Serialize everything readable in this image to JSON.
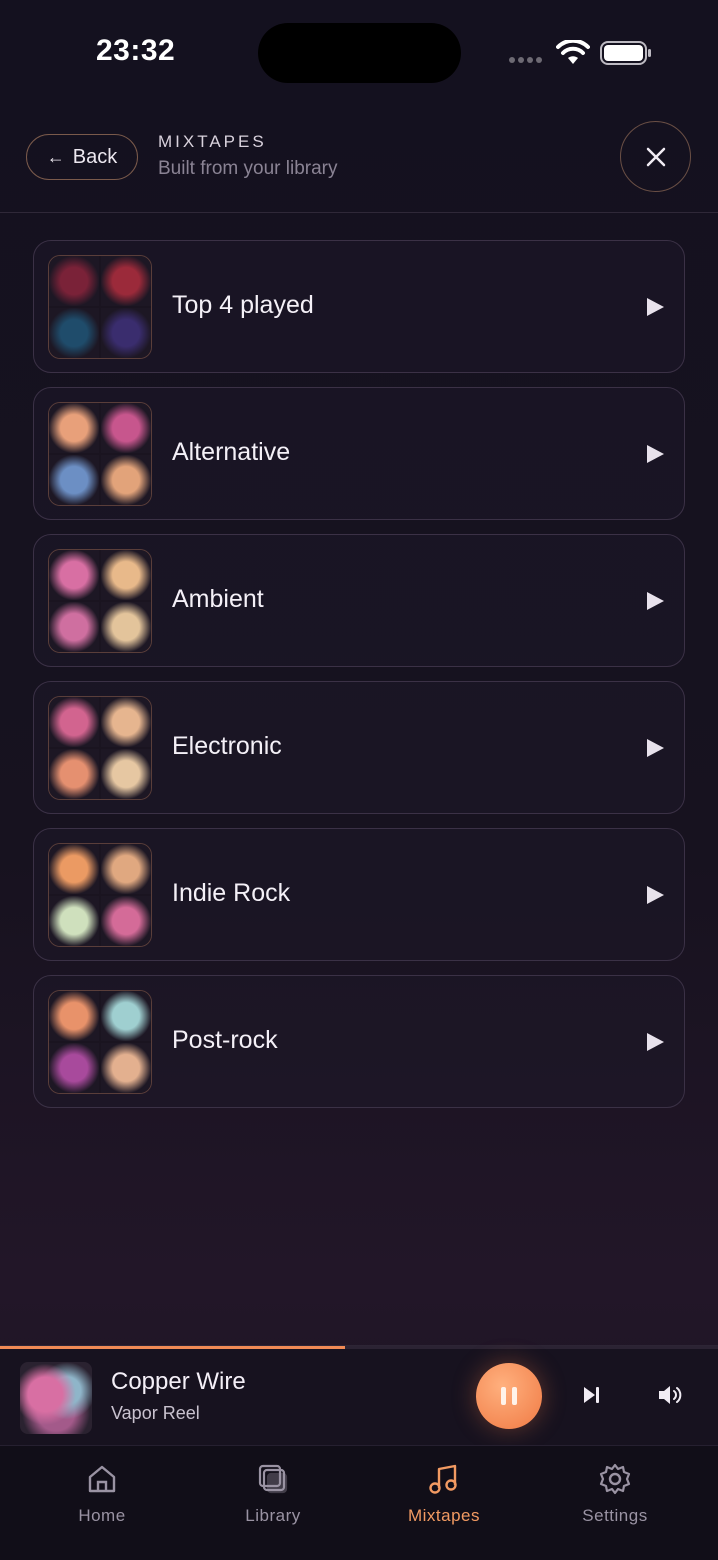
{
  "status": {
    "time": "23:32"
  },
  "header": {
    "back_label": "Back",
    "title": "MIXTAPES",
    "subtitle": "Built from your library"
  },
  "mixtapes": [
    {
      "label": "Top 4 played",
      "art": [
        "#7a2238",
        "#9b2a3a",
        "#1f4c6b",
        "#3a2d6e"
      ]
    },
    {
      "label": "Alternative",
      "art": [
        "#e8a07a",
        "#c7568d",
        "#6c8fc4",
        "#e2a37a"
      ]
    },
    {
      "label": "Ambient",
      "art": [
        "#d86fa3",
        "#e8b98a",
        "#cf6fa0",
        "#e3c49b"
      ]
    },
    {
      "label": "Electronic",
      "art": [
        "#d2648f",
        "#e6b58f",
        "#e59070",
        "#e6c7a2"
      ]
    },
    {
      "label": "Indie Rock",
      "art": [
        "#eb9a63",
        "#e0a880",
        "#cfe0bd",
        "#d46b98"
      ]
    },
    {
      "label": "Post-rock",
      "art": [
        "#e8926a",
        "#9fcfd0",
        "#a84a9c",
        "#e3b08f"
      ]
    }
  ],
  "now_playing": {
    "title": "Copper Wire",
    "artist": "Vapor Reel",
    "progress": 0.48
  },
  "tabs": [
    {
      "label": "Home",
      "icon": "home-icon",
      "active": false
    },
    {
      "label": "Library",
      "icon": "library-icon",
      "active": false
    },
    {
      "label": "Mixtapes",
      "icon": "music-note-icon",
      "active": true
    },
    {
      "label": "Settings",
      "icon": "gear-icon",
      "active": false
    }
  ],
  "colors": {
    "accent": "#f08a55",
    "background": "#14111f"
  }
}
